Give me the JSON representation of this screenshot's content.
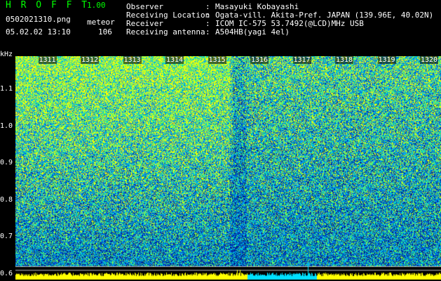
{
  "app": {
    "brand": "H R O F F T",
    "version": "1.00",
    "filename": "0502021310.png",
    "mode": "meteor",
    "datetime": "05.02.02 13:10",
    "count": "106"
  },
  "info": {
    "rows": [
      {
        "key": "Observer",
        "sep": ":",
        "value": "Masayuki Kobayashi"
      },
      {
        "key": "Receiving Location",
        "sep": ":",
        "value": "Ogata-vill. Akita-Pref. JAPAN (139.96E, 40.02N)"
      },
      {
        "key": "Receiver",
        "sep": ":",
        "value": "ICOM IC-575 53.7492(@LCD)MHz USB"
      },
      {
        "key": "Receiving antenna",
        "sep": ":",
        "value": "A504HB(yagi 4el)"
      }
    ]
  },
  "chart_data": {
    "type": "heatmap",
    "title": "",
    "ylabel": "kHz",
    "y_ticks": [
      "1.1",
      "1.0",
      "0.9",
      "0.8",
      "0.7",
      "0.6"
    ],
    "ylim": [
      0.58,
      1.19
    ],
    "x_ticks": [
      "1311",
      "1312",
      "1313",
      "1314",
      "1315",
      "1316",
      "1317",
      "1318",
      "1319",
      "1320"
    ],
    "xlim": [
      "1310",
      "1320"
    ],
    "colormap": [
      "#00208a",
      "#0050d0",
      "#00a0ff",
      "#00e0c0",
      "#80ff40",
      "#ffff00"
    ],
    "level_bar_color": "#ffff00",
    "reference_line_color": "#c0c0c0"
  }
}
